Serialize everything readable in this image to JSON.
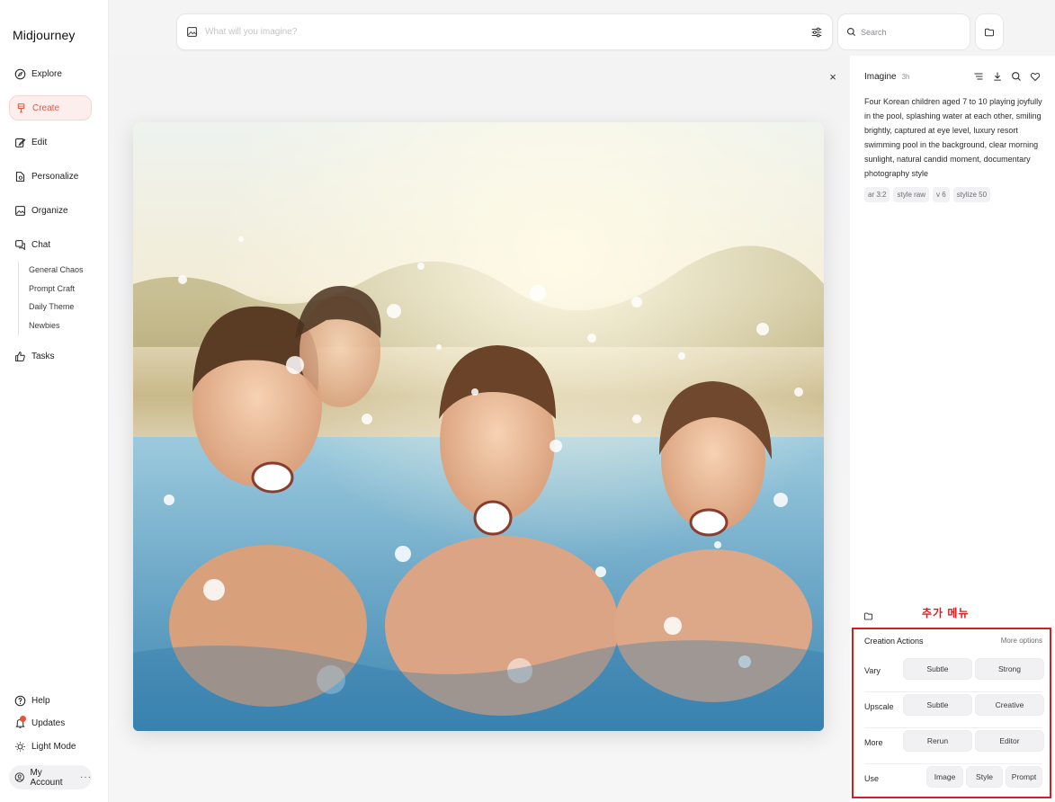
{
  "sidebar": {
    "brand": "Midjourney",
    "nav": {
      "explore": "Explore",
      "create": "Create",
      "edit": "Edit",
      "personalize": "Personalize",
      "organize": "Organize",
      "chat": "Chat",
      "tasks": "Tasks",
      "help": "Help",
      "updates": "Updates",
      "light_mode": "Light Mode"
    },
    "chat_channels": [
      "General Chaos",
      "Prompt Craft",
      "Daily Theme",
      "Newbies"
    ],
    "account": "My Account",
    "account_more": "···"
  },
  "topbar": {
    "imagine_placeholder": "What will you imagine?",
    "search_placeholder": "Search"
  },
  "viewer": {
    "close": "×"
  },
  "panel": {
    "title": "Imagine",
    "time": "3h",
    "prompt": "Four Korean children aged 7 to 10 playing joyfully in the pool, splashing water at each other, smiling brightly, captured at eye level, luxury resort swimming pool in the background, clear morning sunlight, natural candid moment, documentary photography style",
    "tags": [
      "ar 3:2",
      "style raw",
      "v 6",
      "stylize 50"
    ],
    "annotation": "추가 메뉴",
    "actions_title": "Creation Actions",
    "more_options": "More options",
    "rows": {
      "vary": {
        "label": "Vary",
        "b1": "Subtle",
        "b2": "Strong"
      },
      "upscale": {
        "label": "Upscale",
        "b1": "Subtle",
        "b2": "Creative"
      },
      "more": {
        "label": "More",
        "b1": "Rerun",
        "b2": "Editor"
      },
      "use": {
        "label": "Use",
        "b1": "Image",
        "b2": "Style",
        "b3": "Prompt"
      }
    }
  },
  "colors": {
    "accent": "#e05a45",
    "annotation_red": "#d21f26"
  }
}
